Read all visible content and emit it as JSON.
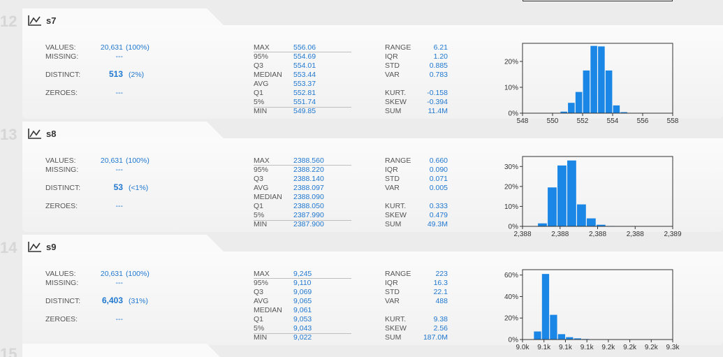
{
  "top_label": "",
  "sections": [
    {
      "index": "12",
      "name": "s7",
      "icon": "line-chart-icon",
      "values": "20,631",
      "values_pct": "(100%)",
      "missing": "---",
      "distinct": "513",
      "distinct_pct": "(2%)",
      "zeroes": "---",
      "quantile_labels": [
        "MAX",
        "95%",
        "Q3",
        "MEDIAN",
        "AVG",
        "Q1",
        "5%",
        "MIN"
      ],
      "quantile_values": [
        "556.06",
        "554.69",
        "554.01",
        "553.44",
        "553.37",
        "552.81",
        "551.74",
        "549.85"
      ],
      "stat_labels": [
        "RANGE",
        "IQR",
        "STD",
        "VAR",
        "KURT.",
        "SKEW",
        "SUM"
      ],
      "stat_values": [
        "6.21",
        "1.20",
        "0.885",
        "0.783",
        "-0.158",
        "-0.394",
        "11.4M"
      ],
      "chart_data": {
        "type": "bar",
        "title": "",
        "x_ticks": [
          "548",
          "550",
          "552",
          "554",
          "556",
          "558"
        ],
        "y_ticks": [
          "0%",
          "10%",
          "20%"
        ],
        "xlim": [
          548,
          558
        ],
        "ylim": [
          0,
          27
        ],
        "bins": [
          {
            "x0": 550.5,
            "x1": 551.0,
            "value": 0.6
          },
          {
            "x0": 551.0,
            "x1": 551.5,
            "value": 4.0
          },
          {
            "x0": 551.5,
            "x1": 552.0,
            "value": 8.2
          },
          {
            "x0": 552.0,
            "x1": 552.5,
            "value": 16.5
          },
          {
            "x0": 552.5,
            "x1": 553.0,
            "value": 26.0
          },
          {
            "x0": 553.0,
            "x1": 553.5,
            "value": 25.8
          },
          {
            "x0": 553.5,
            "x1": 554.0,
            "value": 16.5
          },
          {
            "x0": 554.0,
            "x1": 554.5,
            "value": 3.0
          },
          {
            "x0": 554.5,
            "x1": 555.0,
            "value": 0.4
          }
        ]
      }
    },
    {
      "index": "13",
      "name": "s8",
      "icon": "line-chart-icon",
      "values": "20,631",
      "values_pct": "(100%)",
      "missing": "---",
      "distinct": "53",
      "distinct_pct": "(<1%)",
      "zeroes": "---",
      "quantile_labels": [
        "MAX",
        "95%",
        "Q3",
        "AVG",
        "MEDIAN",
        "Q1",
        "5%",
        "MIN"
      ],
      "quantile_values": [
        "2388.560",
        "2388.220",
        "2388.140",
        "2388.097",
        "2388.090",
        "2388.050",
        "2387.990",
        "2387.900"
      ],
      "stat_labels": [
        "RANGE",
        "IQR",
        "STD",
        "VAR",
        "KURT.",
        "SKEW",
        "SUM"
      ],
      "stat_values": [
        "0.660",
        "0.090",
        "0.071",
        "0.005",
        "0.333",
        "0.479",
        "49.3M"
      ],
      "chart_data": {
        "type": "bar",
        "title": "",
        "x_ticks": [
          "2,388",
          "2,388",
          "2,388",
          "2,388",
          "2,389"
        ],
        "y_ticks": [
          "0%",
          "10%",
          "20%",
          "30%"
        ],
        "xlim": [
          2387.8,
          2388.8
        ],
        "ylim": [
          0,
          35
        ],
        "bins": [
          {
            "x0": 2387.9,
            "x1": 2387.965,
            "value": 1.5
          },
          {
            "x0": 2387.965,
            "x1": 2388.03,
            "value": 19.5
          },
          {
            "x0": 2388.03,
            "x1": 2388.095,
            "value": 30.5
          },
          {
            "x0": 2388.095,
            "x1": 2388.16,
            "value": 33.0
          },
          {
            "x0": 2388.16,
            "x1": 2388.225,
            "value": 11.0
          },
          {
            "x0": 2388.225,
            "x1": 2388.29,
            "value": 4.0
          },
          {
            "x0": 2388.29,
            "x1": 2388.355,
            "value": 0.8
          },
          {
            "x0": 2388.355,
            "x1": 2388.42,
            "value": 0.2
          }
        ]
      }
    },
    {
      "index": "14",
      "name": "s9",
      "icon": "line-chart-icon",
      "values": "20,631",
      "values_pct": "(100%)",
      "missing": "---",
      "distinct": "6,403",
      "distinct_pct": "(31%)",
      "zeroes": "---",
      "quantile_labels": [
        "MAX",
        "95%",
        "Q3",
        "AVG",
        "MEDIAN",
        "Q1",
        "5%",
        "MIN"
      ],
      "quantile_values": [
        "9,245",
        "9,110",
        "9,069",
        "9,065",
        "9,061",
        "9,053",
        "9,043",
        "9,022"
      ],
      "stat_labels": [
        "RANGE",
        "IQR",
        "STD",
        "VAR",
        "KURT.",
        "SKEW",
        "SUM"
      ],
      "stat_values": [
        "223",
        "16.3",
        "22.1",
        "488",
        "9.38",
        "2.56",
        "187.0M"
      ],
      "chart_data": {
        "type": "bar",
        "title": "",
        "x_ticks": [
          "9.0k",
          "9.1k",
          "9.1k",
          "9.1k",
          "9.2k",
          "9.2k",
          "9.2k",
          "9.3k"
        ],
        "y_ticks": [
          "0%",
          "20%",
          "40%",
          "60%"
        ],
        "xlim": [
          9000,
          9300
        ],
        "ylim": [
          0,
          65
        ],
        "bins": [
          {
            "x0": 9022,
            "x1": 9038,
            "value": 7.5
          },
          {
            "x0": 9038,
            "x1": 9054,
            "value": 61.0
          },
          {
            "x0": 9054,
            "x1": 9070,
            "value": 23.0
          },
          {
            "x0": 9070,
            "x1": 9086,
            "value": 5.0
          },
          {
            "x0": 9086,
            "x1": 9102,
            "value": 2.2
          },
          {
            "x0": 9102,
            "x1": 9118,
            "value": 1.1
          },
          {
            "x0": 9118,
            "x1": 9134,
            "value": 0.5
          },
          {
            "x0": 9134,
            "x1": 9150,
            "value": 0.3
          }
        ]
      }
    }
  ],
  "next_index": "15",
  "labels": {
    "values": "VALUES:",
    "missing": "MISSING:",
    "distinct": "DISTINCT:",
    "zeroes": "ZEROES:"
  }
}
